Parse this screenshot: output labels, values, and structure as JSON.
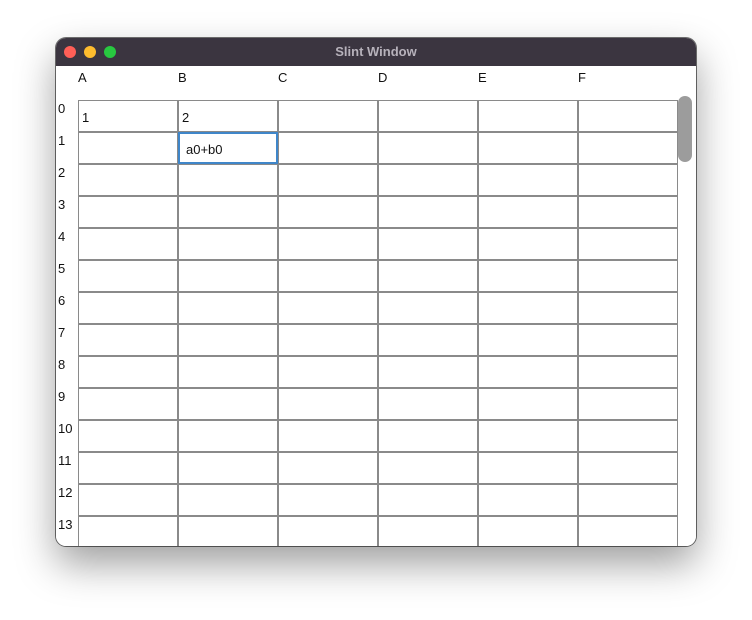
{
  "window": {
    "title": "Slint Window"
  },
  "columns": [
    "A",
    "B",
    "C",
    "D",
    "E",
    "F"
  ],
  "rows": [
    "0",
    "1",
    "2",
    "3",
    "4",
    "5",
    "6",
    "7",
    "8",
    "9",
    "10",
    "11",
    "12",
    "13"
  ],
  "cells": {
    "A0": "1",
    "B0": "2",
    "B1": "a0+b0"
  },
  "selected_cell": "B1"
}
